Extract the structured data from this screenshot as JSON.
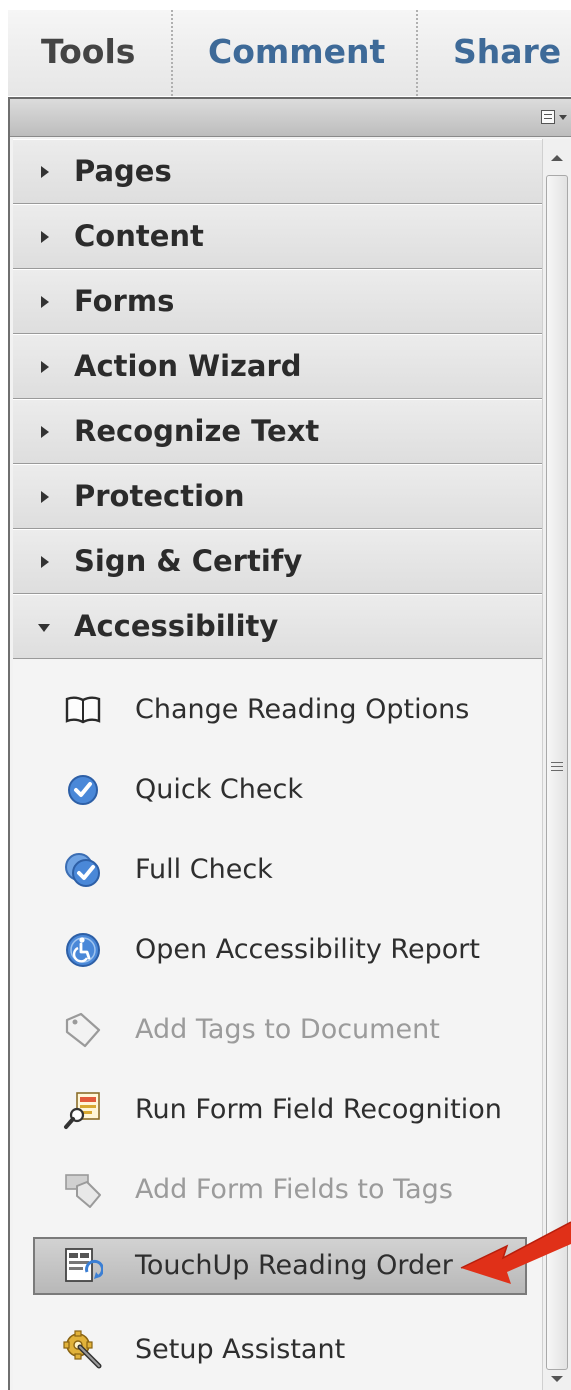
{
  "tabs": {
    "tools": "Tools",
    "comment": "Comment",
    "share": "Share"
  },
  "panel": {
    "options_icon": "panel-options-icon",
    "sections": [
      {
        "label": "Pages",
        "expanded": false
      },
      {
        "label": "Content",
        "expanded": false
      },
      {
        "label": "Forms",
        "expanded": false
      },
      {
        "label": "Action Wizard",
        "expanded": false
      },
      {
        "label": "Recognize Text",
        "expanded": false
      },
      {
        "label": "Protection",
        "expanded": false
      },
      {
        "label": "Sign & Certify",
        "expanded": false
      },
      {
        "label": "Accessibility",
        "expanded": true
      }
    ],
    "accessibility_tools": [
      {
        "label": "Change Reading Options",
        "icon": "book-icon",
        "enabled": true
      },
      {
        "label": "Quick Check",
        "icon": "checkmark-badge-icon",
        "enabled": true
      },
      {
        "label": "Full Check",
        "icon": "double-checkmark-badge-icon",
        "enabled": true
      },
      {
        "label": "Open Accessibility Report",
        "icon": "accessibility-icon",
        "enabled": true
      },
      {
        "label": "Add Tags to Document",
        "icon": "tag-icon",
        "enabled": false
      },
      {
        "label": "Run Form Field Recognition",
        "icon": "form-magnifier-icon",
        "enabled": true
      },
      {
        "label": "Add Form Fields to Tags",
        "icon": "form-tag-icon",
        "enabled": false
      },
      {
        "label": "TouchUp Reading Order",
        "icon": "reading-order-icon",
        "enabled": true,
        "selected": true
      },
      {
        "label": "Setup Assistant",
        "icon": "wrench-gear-icon",
        "enabled": true
      }
    ]
  },
  "colors": {
    "tab_active": "#444444",
    "tab_link": "#3e6a98",
    "callout_arrow": "#e03018"
  }
}
